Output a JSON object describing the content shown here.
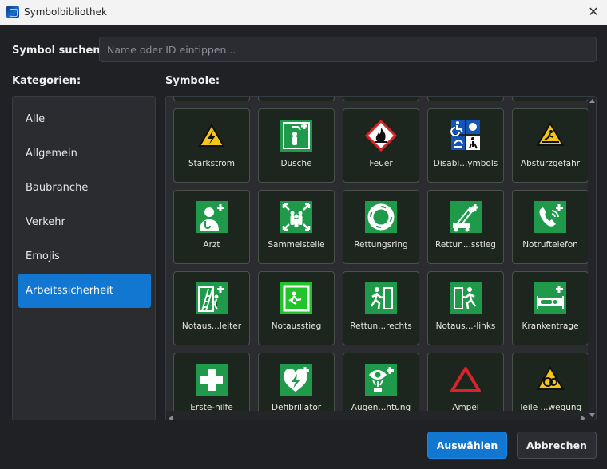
{
  "window": {
    "title": "Symbolbibliothek",
    "close_glyph": "✕"
  },
  "search": {
    "label": "Symbol suchen:",
    "value": "",
    "placeholder": "Name oder ID eintippen..."
  },
  "categories": {
    "heading": "Kategorien:",
    "items": [
      {
        "label": "Alle"
      },
      {
        "label": "Allgemein"
      },
      {
        "label": "Baubranche"
      },
      {
        "label": "Verkehr"
      },
      {
        "label": "Emojis"
      },
      {
        "label": "Arbeitssicherheit",
        "selected": true
      }
    ]
  },
  "symbols": {
    "heading": "Symbole:",
    "tiles": [
      {
        "label": "Starkstrom",
        "icon": "high-voltage-warning-icon"
      },
      {
        "label": "Dusche",
        "icon": "emergency-shower-icon"
      },
      {
        "label": "Feuer",
        "icon": "flammable-hazard-icon"
      },
      {
        "label": "Disabi...ymbols",
        "icon": "disability-symbols-icon"
      },
      {
        "label": "Absturzgefahr",
        "icon": "fall-hazard-icon"
      },
      {
        "label": "Arzt",
        "icon": "doctor-icon"
      },
      {
        "label": "Sammelstelle",
        "icon": "assembly-point-icon"
      },
      {
        "label": "Rettungsring",
        "icon": "lifebuoy-icon"
      },
      {
        "label": "Rettun...sstieg",
        "icon": "rescue-ladder-icon"
      },
      {
        "label": "Notruftelefon",
        "icon": "emergency-phone-icon"
      },
      {
        "label": "Notaus...leiter",
        "icon": "emergency-exit-ladder-icon"
      },
      {
        "label": "Notausstieg",
        "icon": "emergency-hatch-icon"
      },
      {
        "label": "Rettun...rechts",
        "icon": "escape-route-right-icon"
      },
      {
        "label": "Notaus...-links",
        "icon": "emergency-exit-left-icon"
      },
      {
        "label": "Krankentrage",
        "icon": "stretcher-icon"
      },
      {
        "label": "Erste-hilfe",
        "icon": "first-aid-cross-icon"
      },
      {
        "label": "Defibrillator",
        "icon": "defibrillator-icon"
      },
      {
        "label": "Augen...htung",
        "icon": "eye-wash-icon"
      },
      {
        "label": "Ampel",
        "icon": "warning-triangle-icon"
      },
      {
        "label": "Teile ...wegung",
        "icon": "moving-parts-warning-icon"
      }
    ]
  },
  "buttons": {
    "select": "Auswählen",
    "cancel": "Abbrechen"
  },
  "colors": {
    "accent": "#1177d0",
    "safety_green": "#1f9a4a",
    "warning_yellow": "#f5c518",
    "danger_red": "#d8232a"
  }
}
